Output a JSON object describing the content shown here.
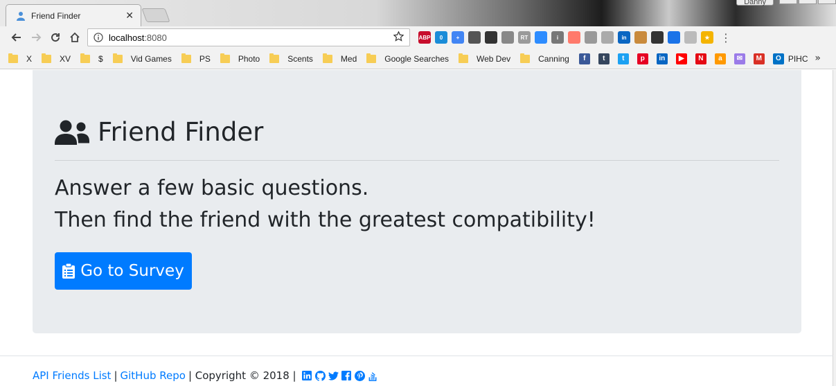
{
  "browser": {
    "tab": {
      "title": "Friend Finder",
      "close_glyph": "✕",
      "favicon": "person-icon"
    },
    "profile_name": "Danny",
    "address": {
      "host": "localhost",
      "port": ":8080"
    },
    "extensions": [
      {
        "name": "adblock-plus-icon",
        "label": "ABP",
        "color": "#c70d2c"
      },
      {
        "name": "extension-badge-icon",
        "label": "0",
        "color": "#1a8cd8"
      },
      {
        "name": "google-plus-box-icon",
        "label": "+",
        "color": "#4285f4"
      },
      {
        "name": "film-reel-icon",
        "label": "",
        "color": "#555555"
      },
      {
        "name": "balls-icon",
        "label": "",
        "color": "#333333"
      },
      {
        "name": "image-search-icon",
        "label": "",
        "color": "#888888"
      },
      {
        "name": "rt-icon",
        "label": "RT",
        "color": "#9a9a9a"
      },
      {
        "name": "zoom-icon",
        "label": "",
        "color": "#2d8cff"
      },
      {
        "name": "info-icon",
        "label": "i",
        "color": "#777777"
      },
      {
        "name": "arrow-right-icon",
        "label": "",
        "color": "#ff7a6b"
      },
      {
        "name": "puzzle-icon",
        "label": "",
        "color": "#999999"
      },
      {
        "name": "pdf-icon",
        "label": "",
        "color": "#aaaaaa"
      },
      {
        "name": "linkedin-icon",
        "label": "in",
        "color": "#0a66c2"
      },
      {
        "name": "tag-icon",
        "label": "",
        "color": "#c98a3c"
      },
      {
        "name": "fullscreen-icon",
        "label": "",
        "color": "#333333"
      },
      {
        "name": "swap-arrows-icon",
        "label": "",
        "color": "#1a73e8"
      },
      {
        "name": "circle-outline-icon",
        "label": "",
        "color": "#bbbbbb"
      },
      {
        "name": "star-extension-icon",
        "label": "★",
        "color": "#f4b400"
      }
    ],
    "bookmarks": [
      {
        "type": "folder",
        "label": "X"
      },
      {
        "type": "folder",
        "label": "XV"
      },
      {
        "type": "folder",
        "label": "$"
      },
      {
        "type": "folder",
        "label": "Vid Games"
      },
      {
        "type": "folder",
        "label": "PS"
      },
      {
        "type": "folder",
        "label": "Photo"
      },
      {
        "type": "folder",
        "label": "Scents"
      },
      {
        "type": "folder",
        "label": "Med"
      },
      {
        "type": "folder",
        "label": "Google Searches"
      },
      {
        "type": "folder",
        "label": "Web Dev"
      },
      {
        "type": "folder",
        "label": "Canning"
      }
    ],
    "bookmark_icons": [
      {
        "name": "facebook-icon",
        "glyph": "f",
        "color": "#3b5998"
      },
      {
        "name": "tumblr-icon",
        "glyph": "t",
        "color": "#36465d"
      },
      {
        "name": "twitter-icon",
        "glyph": "t",
        "color": "#1da1f2"
      },
      {
        "name": "pinterest-icon",
        "glyph": "p",
        "color": "#e60023"
      },
      {
        "name": "linkedin-icon",
        "glyph": "in",
        "color": "#0a66c2"
      },
      {
        "name": "youtube-icon",
        "glyph": "▶",
        "color": "#ff0000"
      },
      {
        "name": "netflix-icon",
        "glyph": "N",
        "color": "#e50914"
      },
      {
        "name": "amazon-icon",
        "glyph": "a",
        "color": "#ff9900"
      },
      {
        "name": "mail-icon",
        "glyph": "✉",
        "color": "#9b7be8"
      },
      {
        "name": "gmail-icon",
        "glyph": "M",
        "color": "#d93025"
      }
    ],
    "bookmark_last": {
      "label": "PIHC",
      "icon": "outlook-icon",
      "color": "#0072c6"
    },
    "bookmark_more": "»"
  },
  "page": {
    "title": "Friend Finder",
    "lead_line1": "Answer a few basic questions.",
    "lead_line2": "Then find the friend with the greatest compatibility!",
    "survey_button": "Go to Survey",
    "footer": {
      "link_api": "API Friends List",
      "sep1": "|",
      "link_repo": "GitHub Repo",
      "copyright": "| Copyright © 2018 |"
    }
  },
  "colors": {
    "primary": "#007bff",
    "jumbotron_bg": "#e9ecef",
    "text": "#212529"
  }
}
